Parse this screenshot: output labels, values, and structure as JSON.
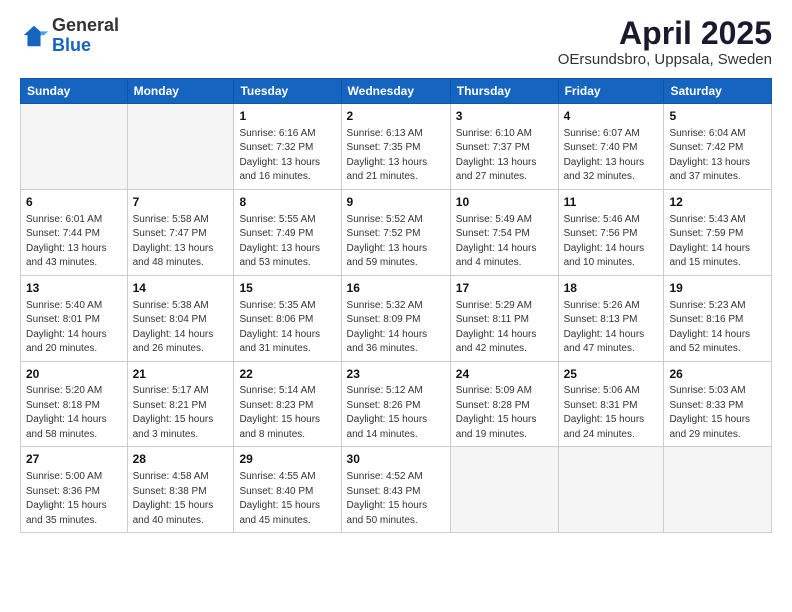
{
  "logo": {
    "line1": "General",
    "line2": "Blue"
  },
  "title": "April 2025",
  "subtitle": "OErsundsbro, Uppsala, Sweden",
  "days_header": [
    "Sunday",
    "Monday",
    "Tuesday",
    "Wednesday",
    "Thursday",
    "Friday",
    "Saturday"
  ],
  "weeks": [
    [
      {
        "day": "",
        "sunrise": "",
        "sunset": "",
        "daylight": "",
        "empty": true
      },
      {
        "day": "",
        "sunrise": "",
        "sunset": "",
        "daylight": "",
        "empty": true
      },
      {
        "day": "1",
        "sunrise": "Sunrise: 6:16 AM",
        "sunset": "Sunset: 7:32 PM",
        "daylight": "Daylight: 13 hours and 16 minutes."
      },
      {
        "day": "2",
        "sunrise": "Sunrise: 6:13 AM",
        "sunset": "Sunset: 7:35 PM",
        "daylight": "Daylight: 13 hours and 21 minutes."
      },
      {
        "day": "3",
        "sunrise": "Sunrise: 6:10 AM",
        "sunset": "Sunset: 7:37 PM",
        "daylight": "Daylight: 13 hours and 27 minutes."
      },
      {
        "day": "4",
        "sunrise": "Sunrise: 6:07 AM",
        "sunset": "Sunset: 7:40 PM",
        "daylight": "Daylight: 13 hours and 32 minutes."
      },
      {
        "day": "5",
        "sunrise": "Sunrise: 6:04 AM",
        "sunset": "Sunset: 7:42 PM",
        "daylight": "Daylight: 13 hours and 37 minutes."
      }
    ],
    [
      {
        "day": "6",
        "sunrise": "Sunrise: 6:01 AM",
        "sunset": "Sunset: 7:44 PM",
        "daylight": "Daylight: 13 hours and 43 minutes."
      },
      {
        "day": "7",
        "sunrise": "Sunrise: 5:58 AM",
        "sunset": "Sunset: 7:47 PM",
        "daylight": "Daylight: 13 hours and 48 minutes."
      },
      {
        "day": "8",
        "sunrise": "Sunrise: 5:55 AM",
        "sunset": "Sunset: 7:49 PM",
        "daylight": "Daylight: 13 hours and 53 minutes."
      },
      {
        "day": "9",
        "sunrise": "Sunrise: 5:52 AM",
        "sunset": "Sunset: 7:52 PM",
        "daylight": "Daylight: 13 hours and 59 minutes."
      },
      {
        "day": "10",
        "sunrise": "Sunrise: 5:49 AM",
        "sunset": "Sunset: 7:54 PM",
        "daylight": "Daylight: 14 hours and 4 minutes."
      },
      {
        "day": "11",
        "sunrise": "Sunrise: 5:46 AM",
        "sunset": "Sunset: 7:56 PM",
        "daylight": "Daylight: 14 hours and 10 minutes."
      },
      {
        "day": "12",
        "sunrise": "Sunrise: 5:43 AM",
        "sunset": "Sunset: 7:59 PM",
        "daylight": "Daylight: 14 hours and 15 minutes."
      }
    ],
    [
      {
        "day": "13",
        "sunrise": "Sunrise: 5:40 AM",
        "sunset": "Sunset: 8:01 PM",
        "daylight": "Daylight: 14 hours and 20 minutes."
      },
      {
        "day": "14",
        "sunrise": "Sunrise: 5:38 AM",
        "sunset": "Sunset: 8:04 PM",
        "daylight": "Daylight: 14 hours and 26 minutes."
      },
      {
        "day": "15",
        "sunrise": "Sunrise: 5:35 AM",
        "sunset": "Sunset: 8:06 PM",
        "daylight": "Daylight: 14 hours and 31 minutes."
      },
      {
        "day": "16",
        "sunrise": "Sunrise: 5:32 AM",
        "sunset": "Sunset: 8:09 PM",
        "daylight": "Daylight: 14 hours and 36 minutes."
      },
      {
        "day": "17",
        "sunrise": "Sunrise: 5:29 AM",
        "sunset": "Sunset: 8:11 PM",
        "daylight": "Daylight: 14 hours and 42 minutes."
      },
      {
        "day": "18",
        "sunrise": "Sunrise: 5:26 AM",
        "sunset": "Sunset: 8:13 PM",
        "daylight": "Daylight: 14 hours and 47 minutes."
      },
      {
        "day": "19",
        "sunrise": "Sunrise: 5:23 AM",
        "sunset": "Sunset: 8:16 PM",
        "daylight": "Daylight: 14 hours and 52 minutes."
      }
    ],
    [
      {
        "day": "20",
        "sunrise": "Sunrise: 5:20 AM",
        "sunset": "Sunset: 8:18 PM",
        "daylight": "Daylight: 14 hours and 58 minutes."
      },
      {
        "day": "21",
        "sunrise": "Sunrise: 5:17 AM",
        "sunset": "Sunset: 8:21 PM",
        "daylight": "Daylight: 15 hours and 3 minutes."
      },
      {
        "day": "22",
        "sunrise": "Sunrise: 5:14 AM",
        "sunset": "Sunset: 8:23 PM",
        "daylight": "Daylight: 15 hours and 8 minutes."
      },
      {
        "day": "23",
        "sunrise": "Sunrise: 5:12 AM",
        "sunset": "Sunset: 8:26 PM",
        "daylight": "Daylight: 15 hours and 14 minutes."
      },
      {
        "day": "24",
        "sunrise": "Sunrise: 5:09 AM",
        "sunset": "Sunset: 8:28 PM",
        "daylight": "Daylight: 15 hours and 19 minutes."
      },
      {
        "day": "25",
        "sunrise": "Sunrise: 5:06 AM",
        "sunset": "Sunset: 8:31 PM",
        "daylight": "Daylight: 15 hours and 24 minutes."
      },
      {
        "day": "26",
        "sunrise": "Sunrise: 5:03 AM",
        "sunset": "Sunset: 8:33 PM",
        "daylight": "Daylight: 15 hours and 29 minutes."
      }
    ],
    [
      {
        "day": "27",
        "sunrise": "Sunrise: 5:00 AM",
        "sunset": "Sunset: 8:36 PM",
        "daylight": "Daylight: 15 hours and 35 minutes."
      },
      {
        "day": "28",
        "sunrise": "Sunrise: 4:58 AM",
        "sunset": "Sunset: 8:38 PM",
        "daylight": "Daylight: 15 hours and 40 minutes."
      },
      {
        "day": "29",
        "sunrise": "Sunrise: 4:55 AM",
        "sunset": "Sunset: 8:40 PM",
        "daylight": "Daylight: 15 hours and 45 minutes."
      },
      {
        "day": "30",
        "sunrise": "Sunrise: 4:52 AM",
        "sunset": "Sunset: 8:43 PM",
        "daylight": "Daylight: 15 hours and 50 minutes."
      },
      {
        "day": "",
        "sunrise": "",
        "sunset": "",
        "daylight": "",
        "empty": true
      },
      {
        "day": "",
        "sunrise": "",
        "sunset": "",
        "daylight": "",
        "empty": true
      },
      {
        "day": "",
        "sunrise": "",
        "sunset": "",
        "daylight": "",
        "empty": true
      }
    ]
  ]
}
